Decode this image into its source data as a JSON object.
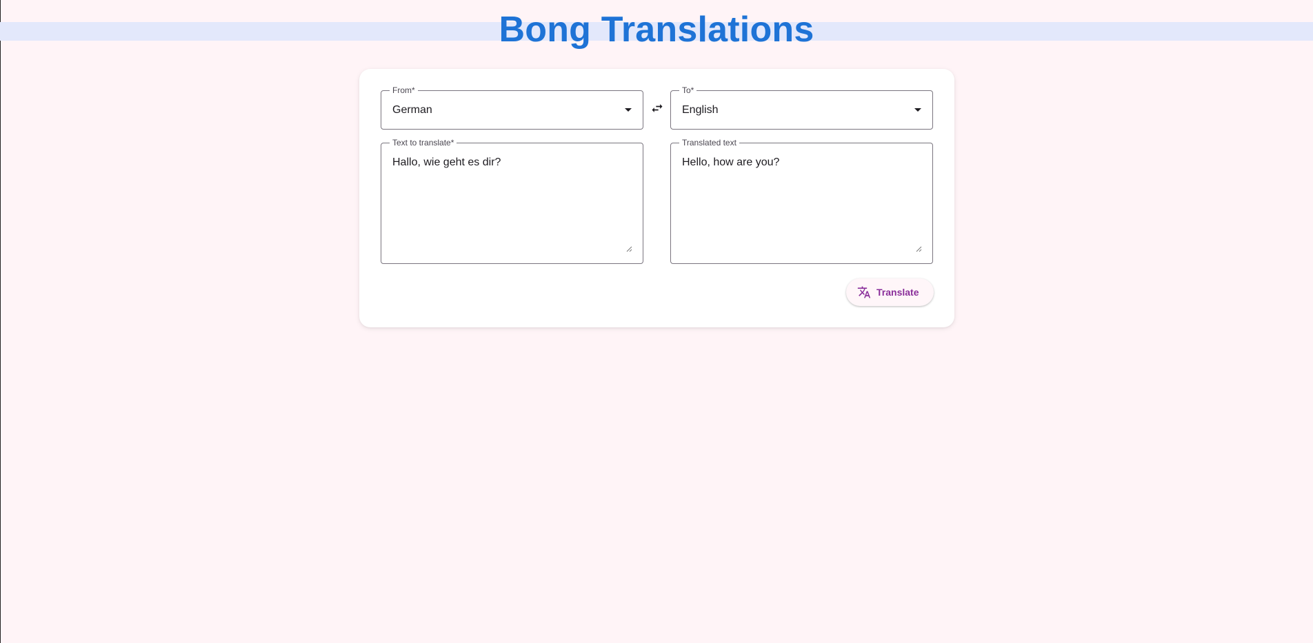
{
  "app": {
    "title": "Bong Translations"
  },
  "translator": {
    "from": {
      "label": "From*",
      "value": "German"
    },
    "to": {
      "label": "To*",
      "value": "English"
    },
    "swap_icon": "swap-horiz-icon",
    "source": {
      "label": "Text to translate*",
      "value": "Hallo, wie geht es dir?"
    },
    "result": {
      "label": "Translated text",
      "value": "Hello, how are you?"
    },
    "translate_button": {
      "label": "Translate",
      "icon": "translate-icon"
    }
  },
  "colors": {
    "title": "#1e73d6",
    "page_background": "#fff4f7",
    "header_band": "#e3e8fb",
    "button_text": "#8a2f9a",
    "outline": "#79747e"
  }
}
